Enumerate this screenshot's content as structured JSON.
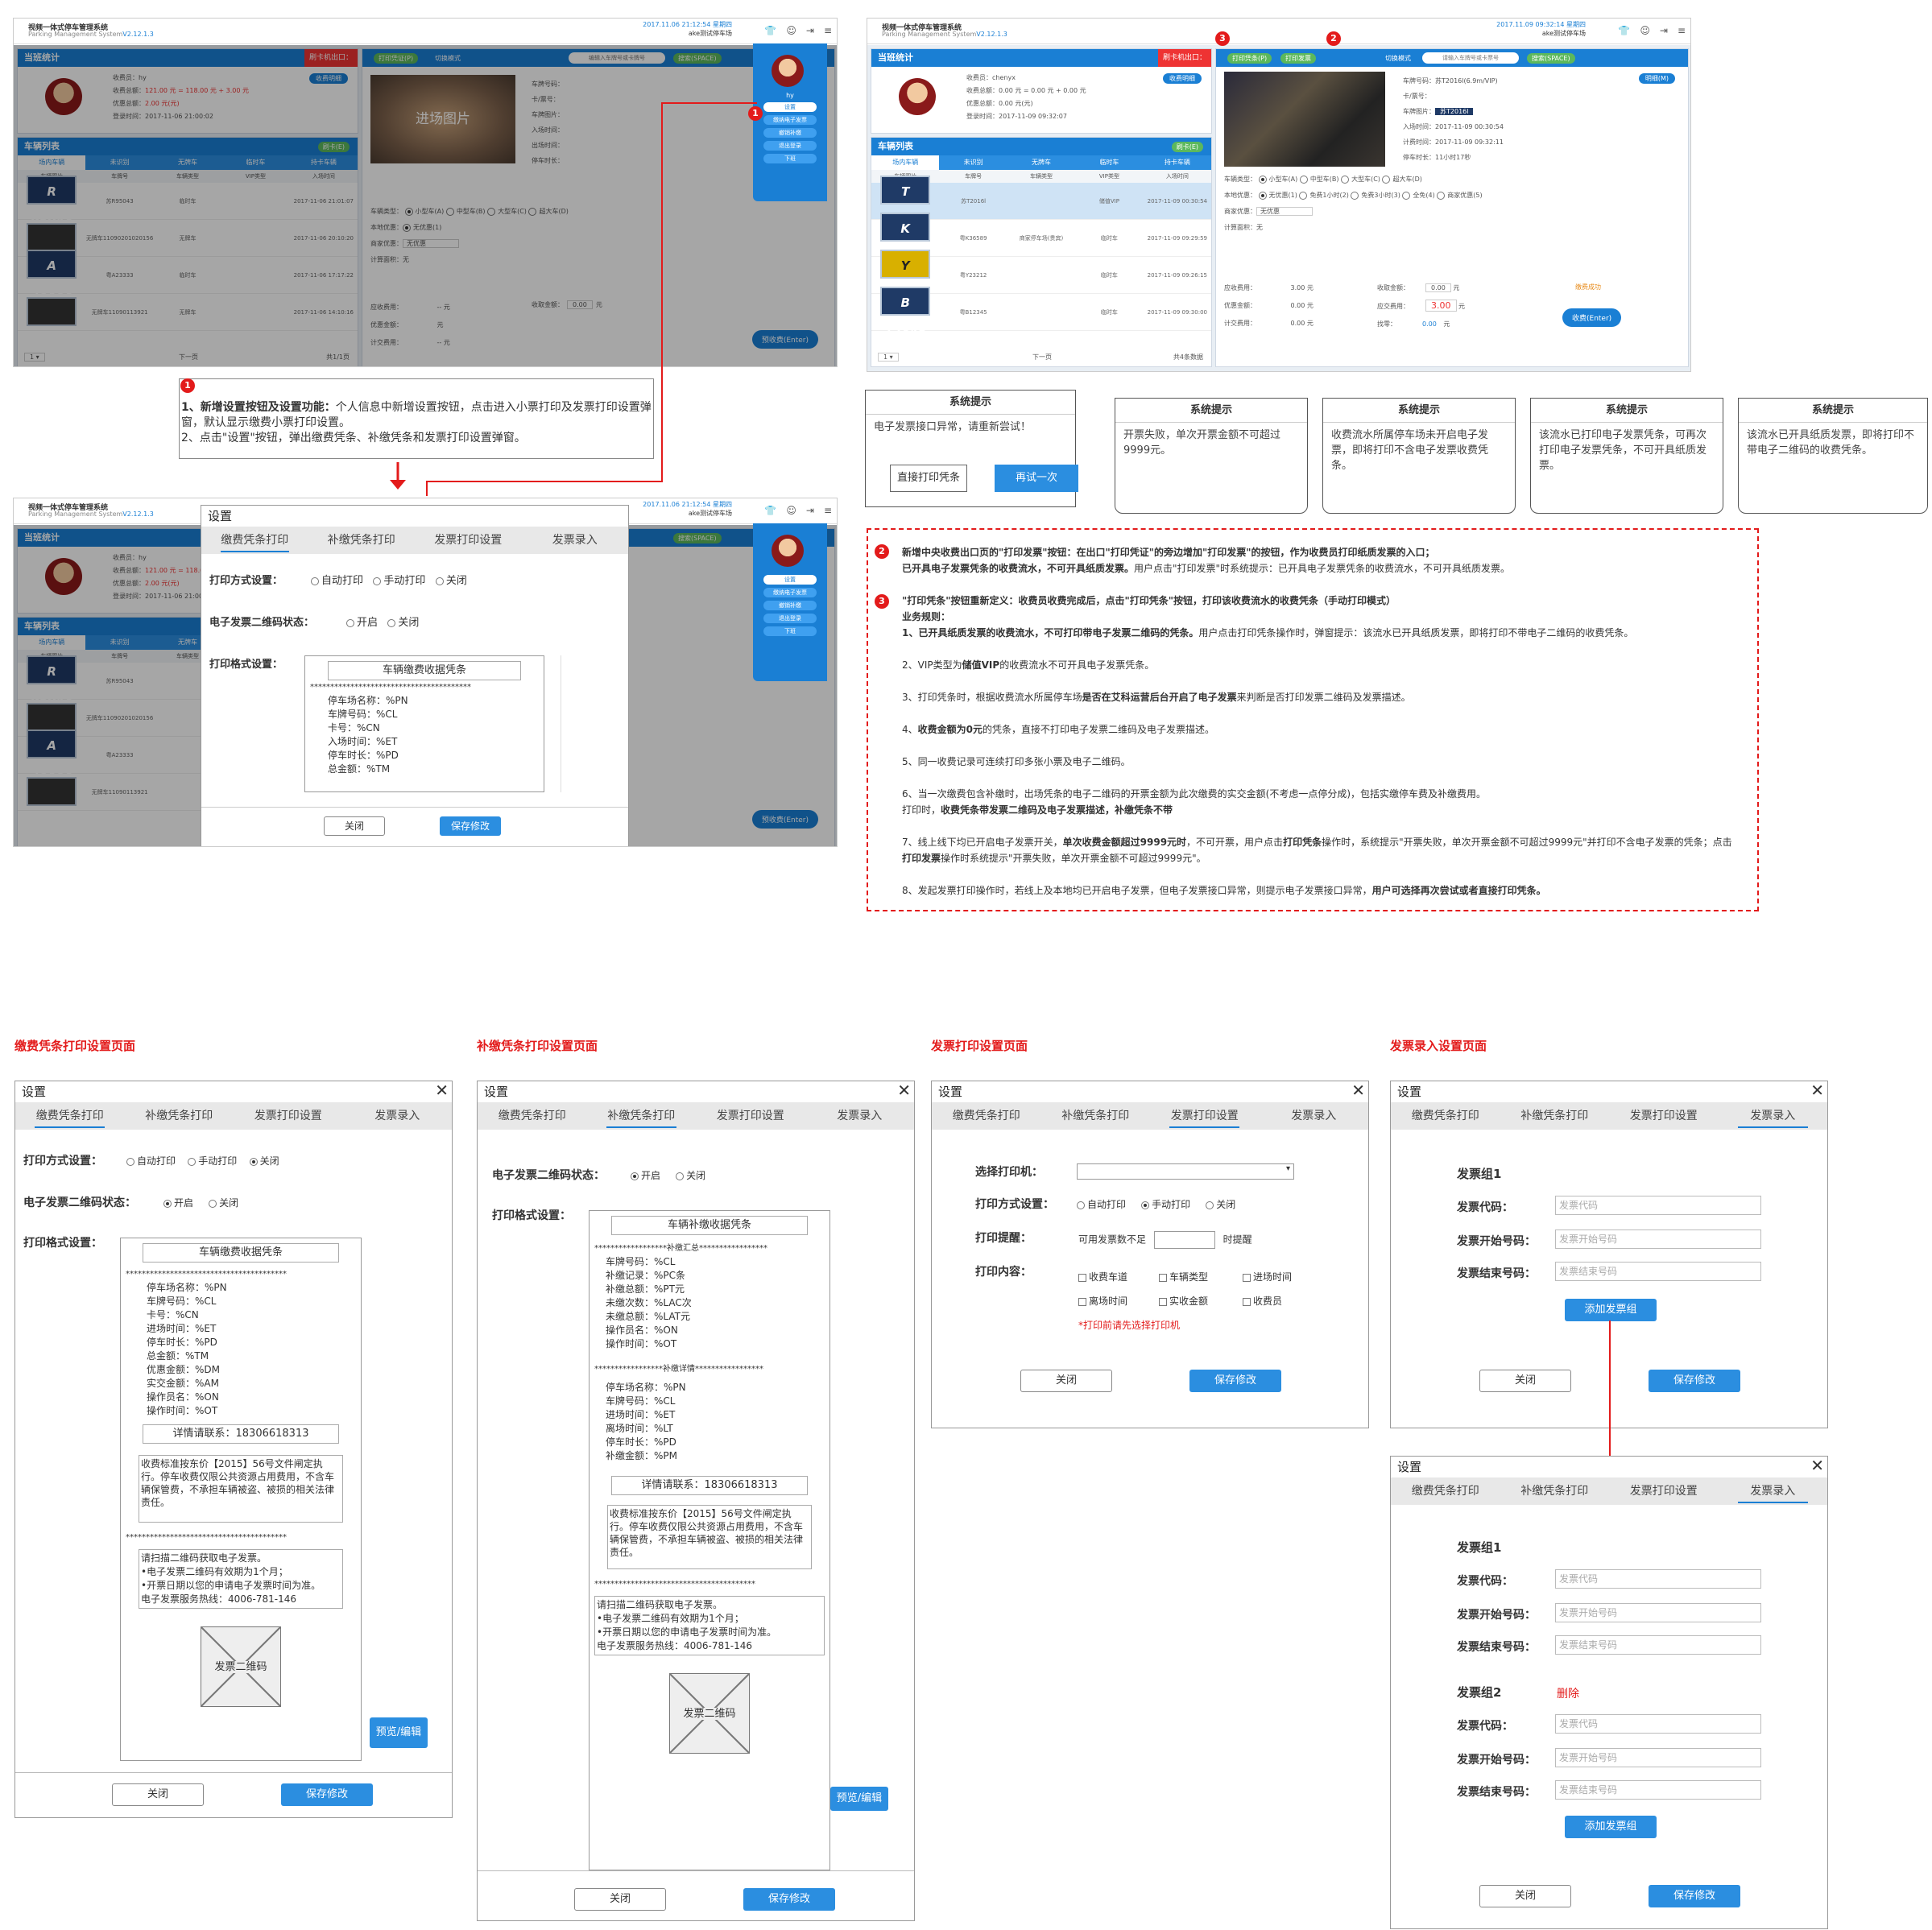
{
  "app": {
    "title_cn": "视频一体式停车管理系统",
    "title_en": "Parking Management System",
    "version": "V2.12.1.3",
    "version_prefix": "Parking Management System",
    "time1": "2017.11.06 21:12:54",
    "station1": "星期四",
    "place1": "ake测试停车场",
    "time2": "2017.11.09 09:32:14",
    "station2": "星期四",
    "place2": "ake测试停车场"
  },
  "screen1": {
    "shift_title": "当班统计",
    "red_tag": "刷卡机出口：",
    "cashier": "收费员：hy",
    "total_label": "收费总额：",
    "total_values": "121.00 元 = 118.00 元 + 3.00 元",
    "discount_label": "优惠总额：",
    "discount_value": "2.00 元(元)",
    "login_time": "登录时间：2017-11-06 21:00:02",
    "detail_btn": "收费明细",
    "car_list_title": "车辆列表",
    "car_list_btn": "刷卡(E)",
    "tabs": [
      "场内车辆",
      "未识别",
      "无牌车",
      "临时车",
      "持卡车辆"
    ],
    "tbl_headers": [
      "车辆图片",
      "车牌号",
      "车辆类型",
      "VIP类型",
      "入场时间"
    ],
    "rows": [
      {
        "plate": "R 95043",
        "plate_no": "苏R95043",
        "type": "临时车",
        "vip": "",
        "time": "2017-11-06 21:01:07"
      },
      {
        "plate": "",
        "plate_no": "无牌车11090201020156",
        "type": "无牌车",
        "vip": "",
        "time": "2017-11-06 20:10:20"
      },
      {
        "plate": "A 23333",
        "plate_no": "粤A23333",
        "type": "临时车",
        "vip": "",
        "time": "2017-11-06 17:17:22"
      },
      {
        "plate": "",
        "plate_no": "无牌车11090113921",
        "type": "无牌车",
        "vip": "",
        "time": "2017-11-06 14:10:16"
      }
    ],
    "top_btns": [
      "打印凭证(P)",
      "切换模式",
      "编辑入车牌号或卡牌号",
      "搜索(SPACE)"
    ],
    "entry_photo": "进场图片",
    "info_labels": [
      "车牌号码：",
      "卡/票号：",
      "车牌图片：",
      "入场时间：",
      "出场时间：",
      "停车时长："
    ],
    "vehicle_type_label": "车辆类型：",
    "vehicle_types": [
      "小型车(A)",
      "中型车(B)",
      "大型车(C)",
      "超大车(D)"
    ],
    "local_label": "本地优惠：",
    "local_opts": [
      "无优惠(1)"
    ],
    "merchant_label": "商家优惠：",
    "merchant_value": "无优惠",
    "calc_label": "计算面积：",
    "calc_value": "无",
    "fee_labels": [
      "应收费用：",
      "优惠金额：",
      "计交费用："
    ],
    "fee_values": [
      "-- 元",
      "元",
      "-- 元"
    ],
    "paid_label": "收取金额：",
    "paid_value": "0.00",
    "paid_unit": "元",
    "submit_btn": "预收费(Enter)",
    "menu_user": "hy",
    "menu_items": [
      "设置",
      "缴纳电子发票",
      "撤销补缴",
      "退出登录",
      "下班"
    ],
    "pager": "1 ▾",
    "pager_next": "下一页",
    "total_count": "共1/1页"
  },
  "annot1": {
    "badge": "1",
    "line1_bold": "1、新增设置按钮及设置功能：",
    "line1": "个人信息中新增设置按钮，点击进入小票打印及发票打印设置弹窗，默认显示缴费小票打印设置。",
    "line2": "2、点击\"设置\"按钮，弹出缴费凭条、补缴凭条和发票打印设置弹窗。"
  },
  "screen2": {
    "cashier": "收费员：chenyx",
    "total": "收费总额：0.00 元 = 0.00 元 + 0.00 元",
    "discount": "优惠总额：0.00 元(元)",
    "login_time": "登录时间：2017-11-09 09:32:07",
    "top_btns": [
      "打印凭条(P)",
      "打印发票",
      "切换模式",
      "请输入车牌号或卡票号",
      "搜索(SPACE)"
    ],
    "plate_label": "车牌号码：",
    "plate_value": "苏T2016l(6.9m/VIP)",
    "info_labels": [
      "卡/票号：",
      "车牌图片：",
      "入场时间：",
      "计费时间：",
      "停车时长："
    ],
    "info_values": [
      "",
      "苏T2016l",
      "2017-11-09 00:30:54",
      "2017-11-09 09:32:11",
      "11小时17秒"
    ],
    "plate_img": "苏T2016l",
    "detail_btn": "明细(M)",
    "vehicle_types": [
      "小型车(A)",
      "中型车(B)",
      "大型车(C)",
      "超大车(D)"
    ],
    "local_opts": [
      "无优惠(1)",
      "免费1小时(2)",
      "免费3小时(3)",
      "全免(4)",
      "商家优惠(5)"
    ],
    "merchant_value": "无优惠",
    "calc_value": "无",
    "fees": [
      "3.00 元",
      "0.00 元",
      "0.00 元"
    ],
    "paid_labels": [
      "收取金额：",
      "应交费用：",
      "找零："
    ],
    "paid_values": [
      "0.00",
      "3.00",
      "0.00"
    ],
    "success": "缴费成功",
    "submit_btn": "收费(Enter)",
    "rows": [
      {
        "plate": "T 2016l",
        "plate_no": "苏T2016l",
        "type": "",
        "vip": "储值VIP",
        "time": "2017-11-09 00:30:54"
      },
      {
        "plate": "K 36589",
        "plate_no": "粤K36589",
        "type": "商家停车场(贵宾)",
        "vip": "临时车",
        "time": "2017-11-09 09:29:59"
      },
      {
        "plate": "Y 23212",
        "plate_no": "粤Y23212",
        "type": "",
        "vip": "临时车",
        "time": "2017-11-09 09:26:15"
      },
      {
        "plate": "B 12345",
        "plate_no": "粤B12345",
        "type": "",
        "vip": "临时车",
        "time": "2017-11-09 09:30:00"
      }
    ],
    "total_count": "共4条数据"
  },
  "tips": [
    {
      "title": "系统提示",
      "body": "电子发票接口异常，请重新尝试！",
      "btn1": "直接打印凭条",
      "btn2": "再试一次"
    },
    {
      "title": "系统提示",
      "body": "开票失败，单次开票金额不可超过9999元。"
    },
    {
      "title": "系统提示",
      "body": "收费流水所属停车场未开启电子发票，即将打印不含电子发票收费凭条。"
    },
    {
      "title": "系统提示",
      "body": "该流水已打印电子发票凭条，可再次打印电子发票凭条，不可开具纸质发票。"
    },
    {
      "title": "系统提示",
      "body": "该流水已开具纸质发票，即将打印不带电子二维码的收费凭条。"
    }
  ],
  "annot2": {
    "b2": "2",
    "p2a": "新增中央收费出口页的\"打印发票\"按钮：在出口\"打印凭证\"的旁边增加\"打印发票\"的按钮，作为收费员打印纸质发票的入口；",
    "p2b_bold": "已开具电子发票凭条的收费流水，不可开具纸质发票。",
    "p2b": "用户点击\"打印发票\"时系统提示：已开具电子发票凭条的收费流水，不可开具纸质发票。",
    "b3": "3",
    "p3a": "\"打印凭条\"按钮重新定义：收费员收费完成后，点击\"打印凭条\"按钮，打印该收费流水的收费凭条（手动打印模式）",
    "p3b": "业务规则：",
    "r1_bold": "1、已开具纸质发票的收费流水，不可打印带电子发票二维码的凭条。",
    "r1": "用户点击打印凭条操作时，弹窗提示：该流水已开具纸质发票，即将打印不带电子二维码的收费凭条。",
    "r2_pre": "2、VIP类型为",
    "r2_bold": "储值VIP",
    "r2": "的收费流水不可开具电子发票凭条。",
    "r3_pre": "3、打印凭条时，根据收费流水所属停车场",
    "r3_bold": "是否在艾科运营后台开启了电子发票",
    "r3": "来判断是否打印发票二维码及发票描述。",
    "r4_pre": "4、",
    "r4_bold": "收费金额为0元",
    "r4": "的凭条，直接不打印电子发票二维码及电子发票描述。",
    "r5": "5、同一收费记录可连续打印多张小票及电子二维码。",
    "r6": "6、当一次缴费包含补缴时，出场凭条的电子二维码的开票金额为此次缴费的实交金额(不考虑一点停分成)，包括实缴停车费及补缴费用。",
    "r6b_pre": "打印时，",
    "r6b_bold": "收费凭条带发票二维码及电子发票描述，补缴凭条不带",
    "r7_pre": "7、线上线下均已开启电子发票开关，",
    "r7_bold": "单次收费金额超过9999元时",
    "r7_mid": "，不可开票，用户点击",
    "r7_bold2": "打印凭条",
    "r7": "操作时，系统提示\"开票失败，单次开票金额不可超过9999元\"并打印不含电子发票的凭条；点击",
    "r7_bold3": "打印发票",
    "r7_end": "操作时系统提示\"开票失败，单次开票金额不可超过9999元\"。",
    "r8": "8、发起发票打印操作时，若线上及本地均已开启电子发票，但电子发票接口异常，则提示电子发票接口异常，",
    "r8_bold": "用户可选择再次尝试或者直接打印凭条。"
  },
  "dialog": {
    "title": "设置",
    "tabs": [
      "缴费凭条打印",
      "补缴凭条打印",
      "发票打印设置",
      "发票录入"
    ],
    "print_mode_label": "打印方式设置：",
    "print_modes": [
      "自动打印",
      "手动打印",
      "关闭"
    ],
    "qr_label": "电子发票二维码状态：",
    "qr_opts": [
      "开启",
      "关闭"
    ],
    "format_label": "打印格式设置：",
    "close_btn": "关闭",
    "save_btn": "保存修改",
    "preview_btn": "预览/编辑"
  },
  "receipt1": {
    "title": "车辆缴费收据凭条",
    "stars": "****************************************",
    "lines": [
      "停车场名称：%PN",
      "车牌号码：%CL",
      "卡号：%CN",
      "进场时间：%ET",
      "停车时长：%PD",
      "总金额：%TM",
      "优惠金额：%DM",
      "实交金额：%AM",
      "操作员名：%ON",
      "操作时间：%OT"
    ],
    "contact": "详情请联系：18306618313",
    "notice": "收费标准按东价【2015】56号文件闸定执行。停车收费仅限公共资源占用费用，不含车辆保管费，不承担车辆被盗、被损的相关法律责任。",
    "einvoice": "请扫描二维码获取电子发票。\n•电子发票二维码有效期为1个月；\n•开票日期以您的申请电子发票时间为准。\n电子发票服务热线：4006-781-146",
    "qr": "发票二维码"
  },
  "receipt1_short": [
    "停车场名称：%PN",
    "车牌号码：%CL",
    "卡号：%CN",
    "入场时间：%ET",
    "停车时长：%PD",
    "总金额：%TM"
  ],
  "receipt2": {
    "title": "车辆补缴收据凭条",
    "summary": "******************补缴汇总*****************",
    "lines_a": [
      "车牌号码：%CL",
      "补缴记录：%PC条",
      "补缴总额：%PT元",
      "未缴次数：%LAC次",
      "未缴总额：%LAT元",
      "操作员名：%ON",
      "操作时间：%OT"
    ],
    "detail": "*****************补缴详情*****************",
    "lines_b": [
      "停车场名称：%PN",
      "车牌号码：%CL",
      "进场时间：%ET",
      "离场时间：%LT",
      "停车时长：%PD",
      "补缴金额：%PM"
    ],
    "contact": "详情请联系：18306618313",
    "notice": "收费标准按东价【2015】56号文件闸定执行。停车收费仅限公共资源占用费用，不含车辆保管费，不承担车辆被盗、被损的相关法律责任。",
    "stars": "****************************************"
  },
  "invoice_print": {
    "printer_label": "选择打印机：",
    "mode_label": "打印方式设置：",
    "remind_label": "打印提醒：",
    "remind_pre": "可用发票数不足",
    "remind_post": "时提醒",
    "content_label": "打印内容：",
    "contents": [
      "收费车道",
      "车辆类型",
      "进场时间",
      "离场时间",
      "实收金额",
      "收费员"
    ],
    "warn": "*打印前请先选择打印机"
  },
  "invoice_entry": {
    "group1": "发票组1",
    "group2": "发票组2",
    "delete": "删除",
    "code_label": "发票代码：",
    "start_label": "发票开始号码：",
    "end_label": "发票结束号码：",
    "code_ph": "发票代码",
    "start_ph": "发票开始号码",
    "end_ph": "发票结束号码",
    "add_btn": "添加发票组"
  },
  "headings": [
    "缴费凭条打印设置页面",
    "补缴凭条打印设置页面",
    "发票打印设置页面",
    "发票录入设置页面"
  ]
}
